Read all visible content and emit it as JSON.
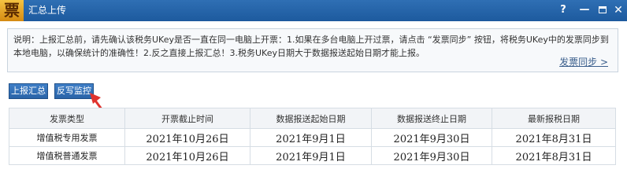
{
  "window": {
    "logo_char": "票",
    "title": "汇总上传",
    "controls": {
      "help": "?",
      "minimize": "—",
      "close": "✕"
    }
  },
  "notice": {
    "text": "说明：上报汇总前，请先确认该税务UKey是否一直在同一电脑上开票：1.如果在多台电脑上开过票，请点击 “发票同步” 按钮，将税务UKey中的发票同步到本地电脑，以确保统计的准确性！2.反之直接上报汇总！3.税务UKey日期大于数据报送起始日期才能上报。",
    "sync_link": "发票同步 >"
  },
  "buttons": {
    "report_summary": "上报汇总",
    "write_back_monitor": "反写监控"
  },
  "table": {
    "headers": [
      "发票类型",
      "开票截止时间",
      "数据报送起始日期",
      "数据报送终止日期",
      "最新报税日期"
    ],
    "rows": [
      [
        "增值税专用发票",
        "2021年10月26日",
        "2021年9月1日",
        "2021年9月30日",
        "2021年8月31日"
      ],
      [
        "增值税普通发票",
        "2021年10月26日",
        "2021年9月1日",
        "2021年9月30日",
        "2021年8月31日"
      ]
    ]
  },
  "colors": {
    "titlebar": "#2a66aa",
    "button": "#2f6db5",
    "arrow": "#e0332e"
  }
}
